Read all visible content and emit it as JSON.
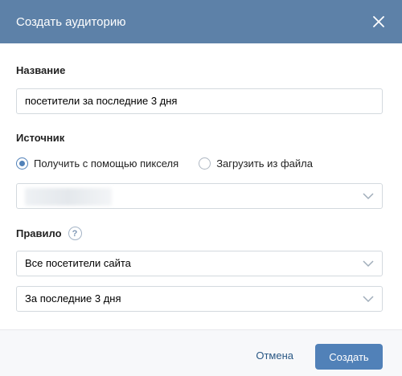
{
  "dialog": {
    "title": "Создать аудиторию",
    "close_icon": "close-icon"
  },
  "name_field": {
    "label": "Название",
    "value": "посетители за последние 3 дня"
  },
  "source": {
    "label": "Источник",
    "options": [
      {
        "label": "Получить с помощью пикселя",
        "checked": true
      },
      {
        "label": "Загрузить из файла",
        "checked": false
      }
    ],
    "pixel_select_value": ""
  },
  "rule": {
    "label": "Правило",
    "help_text": "?",
    "visitors_select": "Все посетители сайта",
    "period_select": "За последние 3 дня"
  },
  "footer": {
    "cancel_label": "Отмена",
    "create_label": "Создать"
  },
  "colors": {
    "header_bg": "#5d81a8",
    "accent": "#5181b8",
    "link": "#2a5885"
  }
}
